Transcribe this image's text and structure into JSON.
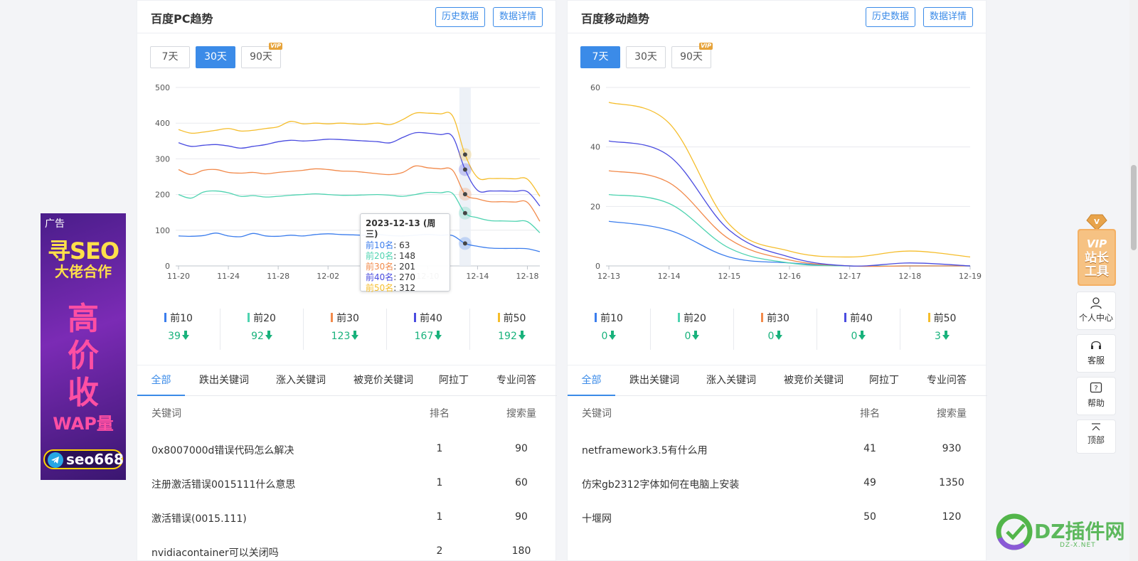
{
  "left": {
    "title": "百度PC趋势",
    "btn_history": "历史数据",
    "btn_detail": "数据详情",
    "ranges": [
      "7天",
      "30天",
      "90天"
    ],
    "active_range": "30天",
    "vip_badge": "VIP",
    "chart_data": {
      "type": "line",
      "x": [
        "11-20",
        "11-21",
        "11-22",
        "11-23",
        "11-24",
        "11-25",
        "11-26",
        "11-27",
        "11-28",
        "11-29",
        "11-30",
        "12-01",
        "12-02",
        "12-03",
        "12-04",
        "12-05",
        "12-06",
        "12-07",
        "12-08",
        "12-09",
        "12-10",
        "12-11",
        "12-12",
        "12-13",
        "12-14",
        "12-15",
        "12-16",
        "12-17",
        "12-18",
        "12-19"
      ],
      "x_ticks": [
        "11-20",
        "11-24",
        "11-28",
        "12-02",
        "12-06",
        "12-10",
        "12-14",
        "12-18"
      ],
      "ylim": [
        0,
        500
      ],
      "y_ticks": [
        "0",
        "100",
        "200",
        "300",
        "400",
        "500"
      ],
      "series": [
        {
          "name": "前10",
          "color": "#3b7ded",
          "values": [
            84,
            83,
            85,
            92,
            84,
            82,
            91,
            84,
            83,
            86,
            84,
            88,
            90,
            88,
            87,
            86,
            88,
            85,
            84,
            86,
            88,
            86,
            85,
            63,
            55,
            50,
            49,
            49,
            48,
            40
          ]
        },
        {
          "name": "前20",
          "color": "#4ed3b0",
          "values": [
            200,
            190,
            207,
            210,
            205,
            195,
            197,
            193,
            195,
            198,
            200,
            202,
            200,
            198,
            198,
            199,
            200,
            198,
            195,
            200,
            206,
            205,
            203,
            148,
            135,
            127,
            126,
            125,
            124,
            93
          ]
        },
        {
          "name": "前30",
          "color": "#f28a4b",
          "values": [
            270,
            256,
            268,
            270,
            262,
            260,
            262,
            258,
            262,
            265,
            268,
            272,
            270,
            266,
            265,
            262,
            258,
            256,
            262,
            280,
            275,
            272,
            268,
            201,
            188,
            180,
            180,
            179,
            178,
            125
          ]
        },
        {
          "name": "前40",
          "color": "#4a4ce0",
          "values": [
            345,
            335,
            338,
            340,
            336,
            330,
            335,
            340,
            348,
            352,
            350,
            352,
            355,
            354,
            352,
            350,
            348,
            345,
            360,
            373,
            372,
            368,
            362,
            270,
            212,
            210,
            210,
            209,
            208,
            168
          ]
        },
        {
          "name": "前50",
          "color": "#f5bd2b",
          "values": [
            382,
            372,
            375,
            380,
            385,
            378,
            380,
            385,
            390,
            405,
            398,
            400,
            398,
            400,
            398,
            397,
            400,
            396,
            410,
            428,
            428,
            426,
            420,
            312,
            248,
            245,
            245,
            244,
            243,
            195
          ]
        }
      ],
      "tooltip": {
        "index": 23,
        "date": "2023-12-13 (周三)",
        "rows": [
          {
            "label": "前10名",
            "value": "63",
            "color": "#3b7ded"
          },
          {
            "label": "前20名",
            "value": "148",
            "color": "#4ed3b0"
          },
          {
            "label": "前30名",
            "value": "201",
            "color": "#f28a4b"
          },
          {
            "label": "前40名",
            "value": "270",
            "color": "#4a4ce0"
          },
          {
            "label": "前50名",
            "value": "312",
            "color": "#f5bd2b"
          }
        ]
      }
    },
    "legend": [
      {
        "name": "前10",
        "value": "39",
        "color": "#3b7ded"
      },
      {
        "name": "前20",
        "value": "92",
        "color": "#4ed3b0"
      },
      {
        "name": "前30",
        "value": "123",
        "color": "#f28a4b"
      },
      {
        "name": "前40",
        "value": "167",
        "color": "#4a4ce0"
      },
      {
        "name": "前50",
        "value": "192",
        "color": "#f5bd2b"
      }
    ],
    "tabs": [
      "全部",
      "跌出关键词",
      "涨入关键词",
      "被竞价关键词",
      "阿拉丁",
      "专业问答"
    ],
    "active_tab": 0,
    "table_head": {
      "keyword": "关键词",
      "rank": "排名",
      "volume": "搜索量"
    },
    "rows": [
      {
        "keyword": "0x8007000d错误代码怎么解决",
        "rank": "1",
        "volume": "90"
      },
      {
        "keyword": "注册激活错误0015111什么意思",
        "rank": "1",
        "volume": "60"
      },
      {
        "keyword": "激活错误(0015.111)",
        "rank": "1",
        "volume": "90"
      },
      {
        "keyword": "nvidiacontainer可以关闭吗",
        "rank": "2",
        "volume": "180"
      }
    ]
  },
  "right": {
    "title": "百度移动趋势",
    "btn_history": "历史数据",
    "btn_detail": "数据详情",
    "ranges": [
      "7天",
      "30天",
      "90天"
    ],
    "active_range": "7天",
    "vip_badge": "VIP",
    "chart_data": {
      "type": "line",
      "x": [
        "12-13",
        "12-14",
        "12-15",
        "12-16",
        "12-17",
        "12-18",
        "12-19"
      ],
      "x_ticks": [
        "12-13",
        "12-14",
        "12-15",
        "12-16",
        "12-17",
        "12-18",
        "12-19"
      ],
      "ylim": [
        0,
        60
      ],
      "y_ticks": [
        "0",
        "20",
        "40",
        "60"
      ],
      "series": [
        {
          "name": "前10",
          "color": "#3b7ded",
          "values": [
            15,
            12,
            3,
            1,
            0,
            0,
            0
          ]
        },
        {
          "name": "前20",
          "color": "#4ed3b0",
          "values": [
            24,
            21,
            6,
            1,
            0,
            0,
            0
          ]
        },
        {
          "name": "前30",
          "color": "#f28a4b",
          "values": [
            32,
            28,
            9,
            2,
            0,
            0,
            0
          ]
        },
        {
          "name": "前40",
          "color": "#4a4ce0",
          "values": [
            42,
            37,
            12,
            3,
            0,
            1,
            0
          ]
        },
        {
          "name": "前50",
          "color": "#f5bd2b",
          "values": [
            55,
            48,
            14,
            5,
            3,
            5,
            3
          ]
        }
      ]
    },
    "legend": [
      {
        "name": "前10",
        "value": "0",
        "color": "#3b7ded"
      },
      {
        "name": "前20",
        "value": "0",
        "color": "#4ed3b0"
      },
      {
        "name": "前30",
        "value": "0",
        "color": "#f28a4b"
      },
      {
        "name": "前40",
        "value": "0",
        "color": "#4a4ce0"
      },
      {
        "name": "前50",
        "value": "3",
        "color": "#f5bd2b"
      }
    ],
    "tabs": [
      "全部",
      "跌出关键词",
      "涨入关键词",
      "被竞价关键词",
      "阿拉丁",
      "专业问答"
    ],
    "active_tab": 0,
    "table_head": {
      "keyword": "关键词",
      "rank": "排名",
      "volume": "搜索量"
    },
    "rows": [
      {
        "keyword": "netframework3.5有什么用",
        "rank": "41",
        "volume": "930"
      },
      {
        "keyword": "仿宋gb2312字体如何在电脑上安装",
        "rank": "49",
        "volume": "1350"
      },
      {
        "keyword": "十堰网",
        "rank": "50",
        "volume": "120"
      }
    ]
  },
  "ad": {
    "label": "广告",
    "line1": "寻SEO",
    "line2": "大佬合作",
    "big": [
      "高",
      "价",
      "收"
    ],
    "line3": "WAP量",
    "contact": "seo668"
  },
  "sidebar": {
    "vip_label": "VIP",
    "vip_text": "站长工具",
    "items": [
      {
        "label": "个人中心",
        "icon": "user-icon"
      },
      {
        "label": "客服",
        "icon": "headset-icon"
      },
      {
        "label": "帮助",
        "icon": "help-icon"
      },
      {
        "label": "顶部",
        "icon": "to-top-icon"
      }
    ]
  },
  "watermark": {
    "text": "DZ插件网",
    "sub": "DZ-X.NET"
  }
}
